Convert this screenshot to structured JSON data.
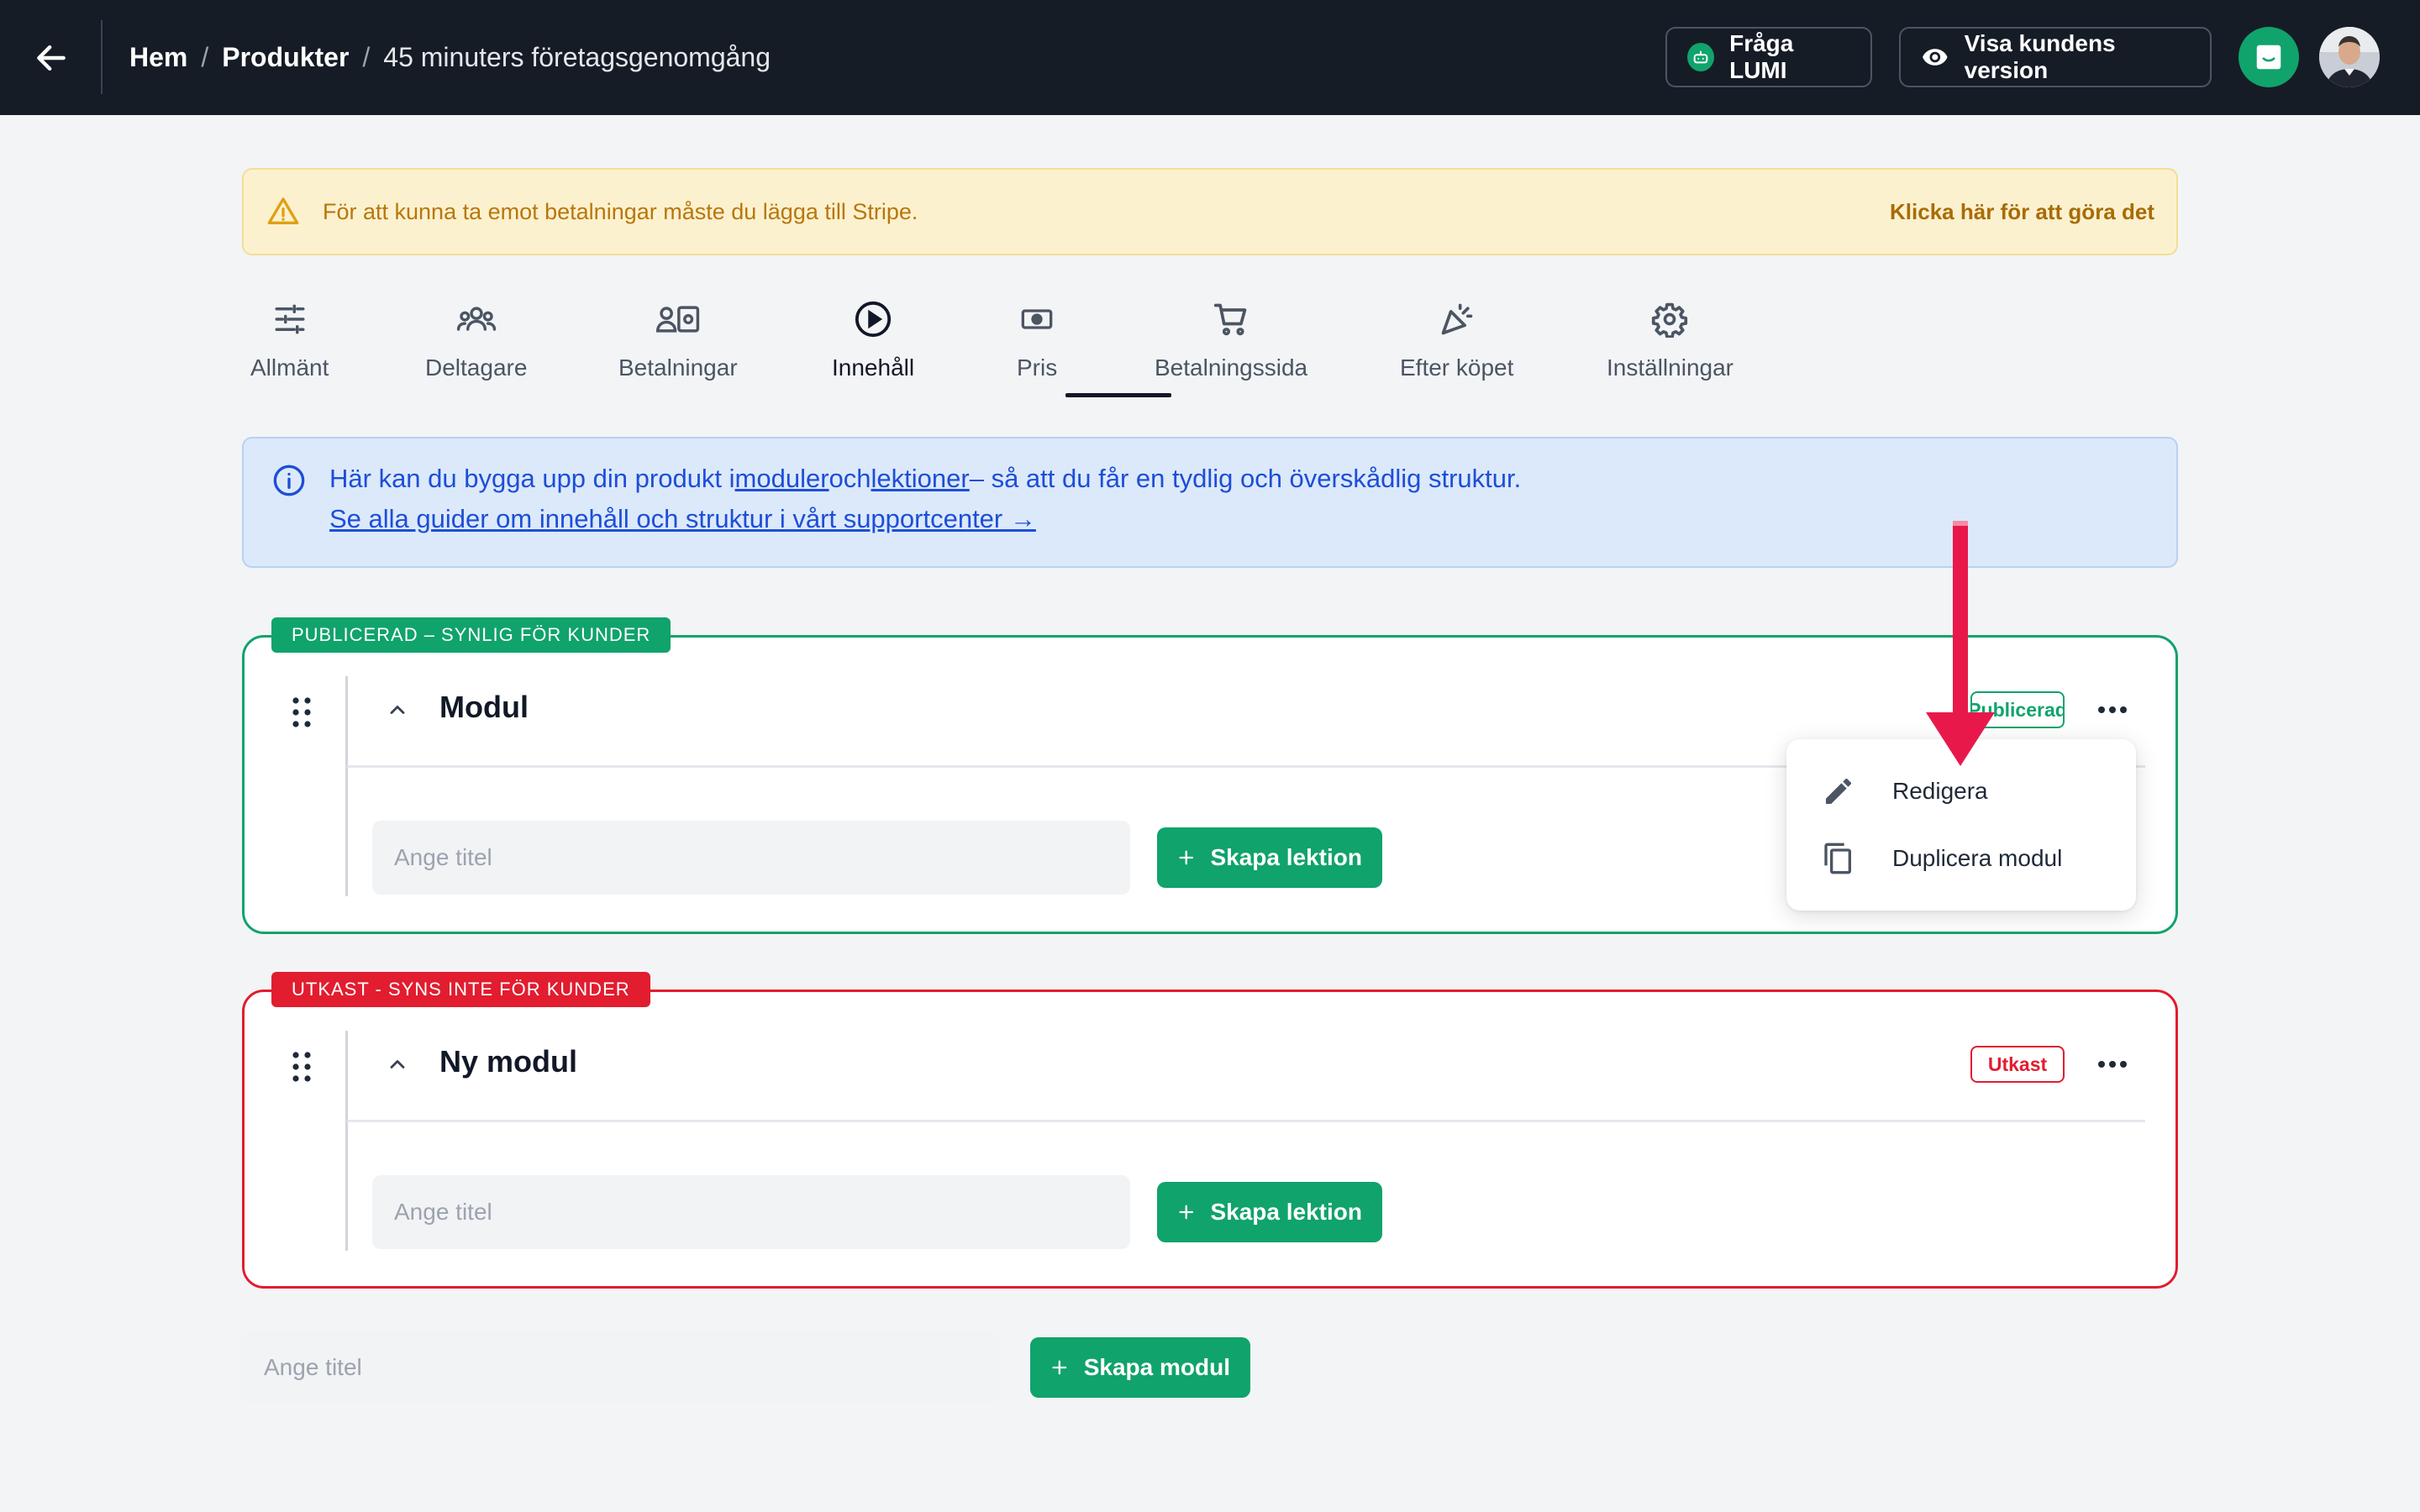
{
  "topbar": {
    "breadcrumb": {
      "home": "Hem",
      "products": "Produkter",
      "current": "45 minuters företagsgenomgång",
      "separator": "/"
    },
    "ask_lumi_label": "Fråga LUMI",
    "customer_view_label": "Visa kundens version",
    "icons": {
      "back": "arrow-left-icon",
      "lumi": "robot-icon",
      "eye": "eye-icon",
      "chat": "chat-icon"
    }
  },
  "warning": {
    "text": "För att kunna ta emot betalningar måste du lägga till Stripe.",
    "link": "Klicka här för att göra det",
    "icon": "warning-triangle-icon"
  },
  "tabs": [
    {
      "label": "Allmänt",
      "icon": "sliders-icon"
    },
    {
      "label": "Deltagare",
      "icon": "users-icon"
    },
    {
      "label": "Betalningar",
      "icon": "payments-icon"
    },
    {
      "label": "Innehåll",
      "icon": "play-circle-icon"
    },
    {
      "label": "Pris",
      "icon": "banknote-icon"
    },
    {
      "label": "Betalningssida",
      "icon": "cart-icon"
    },
    {
      "label": "Efter köpet",
      "icon": "party-icon"
    },
    {
      "label": "Inställningar",
      "icon": "gear-icon"
    }
  ],
  "active_tab": "Innehåll",
  "info": {
    "prefix": "Här kan du bygga upp din produkt i",
    "link_modules": "moduler",
    "middle": "och",
    "link_lessons": "lektioner",
    "suffix": "– så att du får en tydlig och överskådlig struktur.",
    "guide_link": "Se alla guider om innehåll och struktur i vårt supportcenter →"
  },
  "modules": [
    {
      "status_tag": "PUBLICERAD – SYNLIG FÖR KUNDER",
      "title": "Modul",
      "badge": "Publicerad",
      "input_placeholder": "Ange titel",
      "button_label": "Skapa lektion"
    },
    {
      "status_tag": "UTKAST - SYNS INTE FÖR KUNDER",
      "title": "Ny modul",
      "badge": "Utkast",
      "input_placeholder": "Ange titel",
      "button_label": "Skapa lektion"
    }
  ],
  "new_module": {
    "input_placeholder": "Ange titel",
    "button_label": "Skapa modul"
  },
  "dropdown": {
    "items": [
      {
        "label": "Redigera",
        "icon": "pencil-icon"
      },
      {
        "label": "Duplicera modul",
        "icon": "copy-icon"
      }
    ]
  },
  "colors": {
    "topbar": "#161c26",
    "accent_green": "#10a36b",
    "draft_red": "#e11d2f",
    "warning_bg": "#fcf1cf",
    "info_bg": "#dce9fa",
    "info_text": "#1d4ed8",
    "annotation_arrow": "#e8194a"
  }
}
